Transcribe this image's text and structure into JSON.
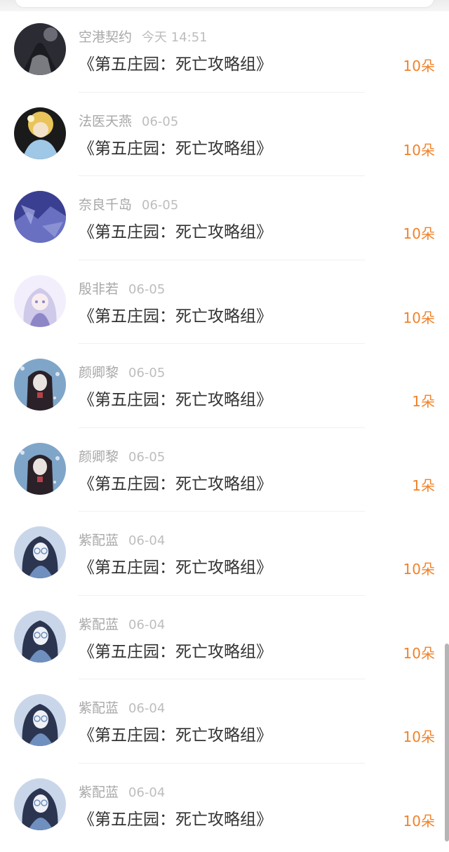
{
  "items": [
    {
      "user": "空港契约",
      "time": "今天 14:51",
      "title": "《第五庄园：死亡攻略组》",
      "amount": "10朵",
      "avatar_icon": "avatar-dark-figure",
      "colors": [
        "#2b2b33",
        "#6b6b75",
        "#c9c9cf"
      ]
    },
    {
      "user": "法医天燕",
      "time": "06-05",
      "title": "《第五庄园：死亡攻略组》",
      "amount": "10朵",
      "avatar_icon": "avatar-anime-blonde",
      "colors": [
        "#1a1a1a",
        "#e8c45a",
        "#9fc7e6"
      ]
    },
    {
      "user": "奈良千岛",
      "time": "06-05",
      "title": "《第五庄园：死亡攻略组》",
      "amount": "10朵",
      "avatar_icon": "avatar-blue-scene",
      "colors": [
        "#3b3f92",
        "#6970c2",
        "#aab0e6"
      ]
    },
    {
      "user": "殷非若",
      "time": "06-05",
      "title": "《第五庄园：死亡攻略组》",
      "amount": "10朵",
      "avatar_icon": "avatar-anime-silver",
      "colors": [
        "#cfc9ea",
        "#8d86c7",
        "#f2eefb"
      ]
    },
    {
      "user": "颜卿黎",
      "time": "06-05",
      "title": "《第五庄园：死亡攻略组》",
      "amount": "1朵",
      "avatar_icon": "avatar-anime-darkhair",
      "colors": [
        "#7fa6c9",
        "#2a2228",
        "#e9e3df"
      ]
    },
    {
      "user": "颜卿黎",
      "time": "06-05",
      "title": "《第五庄园：死亡攻略组》",
      "amount": "1朵",
      "avatar_icon": "avatar-anime-darkhair",
      "colors": [
        "#7fa6c9",
        "#2a2228",
        "#e9e3df"
      ]
    },
    {
      "user": "紫配蓝",
      "time": "06-04",
      "title": "《第五庄园：死亡攻略组》",
      "amount": "10朵",
      "avatar_icon": "avatar-anime-glasses",
      "colors": [
        "#6f8fbf",
        "#2c3550",
        "#c9d6ea"
      ]
    },
    {
      "user": "紫配蓝",
      "time": "06-04",
      "title": "《第五庄园：死亡攻略组》",
      "amount": "10朵",
      "avatar_icon": "avatar-anime-glasses",
      "colors": [
        "#6f8fbf",
        "#2c3550",
        "#c9d6ea"
      ]
    },
    {
      "user": "紫配蓝",
      "time": "06-04",
      "title": "《第五庄园：死亡攻略组》",
      "amount": "10朵",
      "avatar_icon": "avatar-anime-glasses",
      "colors": [
        "#6f8fbf",
        "#2c3550",
        "#c9d6ea"
      ]
    },
    {
      "user": "紫配蓝",
      "time": "06-04",
      "title": "《第五庄园：死亡攻略组》",
      "amount": "10朵",
      "avatar_icon": "avatar-anime-glasses",
      "colors": [
        "#6f8fbf",
        "#2c3550",
        "#c9d6ea"
      ]
    }
  ],
  "theme": {
    "accent": "#f0822a",
    "title_color": "#333333",
    "meta_color": "#a8a8a8"
  }
}
